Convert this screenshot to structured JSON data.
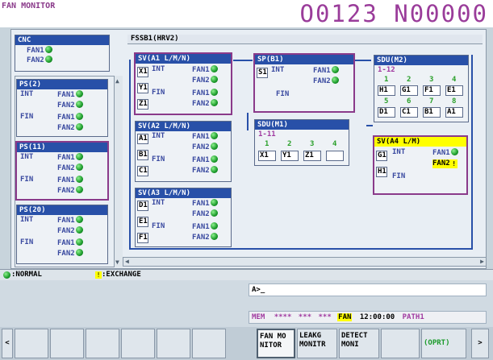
{
  "header": {
    "screen_title": "FAN MONITOR",
    "program_no": "O0123 N00000"
  },
  "cnc": {
    "title": "CNC",
    "fan1": "FAN1",
    "fan2": "FAN2"
  },
  "ps2": {
    "title": "PS(2)",
    "int": "INT",
    "fin": "FIN",
    "fan1": "FAN1",
    "fan2": "FAN2"
  },
  "ps11": {
    "title": "PS(11)",
    "int": "INT",
    "fin": "FIN",
    "fan1": "FAN1",
    "fan2": "FAN2"
  },
  "ps20": {
    "title": "PS(20)",
    "int": "INT",
    "fin": "FIN",
    "fan1": "FAN1",
    "fan2": "FAN2"
  },
  "fssb": {
    "title": "FSSB1(HRV2)"
  },
  "sva1": {
    "title": "SV(A1 L/M/N)",
    "axes": [
      "X1",
      "Y1",
      "Z1"
    ]
  },
  "sva2": {
    "title": "SV(A2 L/M/N)",
    "axes": [
      "A1",
      "B1",
      "C1"
    ]
  },
  "sva3": {
    "title": "SV(A3 L/M/N)",
    "axes": [
      "D1",
      "E1",
      "F1"
    ]
  },
  "sp": {
    "title": "SP(B1)",
    "axis": "S1",
    "int": "INT",
    "fin": "FIN",
    "fan1": "FAN1",
    "fan2": "FAN2"
  },
  "sdum1": {
    "title": "SDU(M1)",
    "range": "1-11",
    "nums": [
      "1",
      "2",
      "3",
      "4"
    ],
    "axes": [
      "X1",
      "Y1",
      "Z1",
      ""
    ]
  },
  "sdum2": {
    "title": "SDU(M2)",
    "range": "1-12",
    "nums": [
      "1",
      "2",
      "3",
      "4",
      "5",
      "6",
      "7",
      "8"
    ],
    "axes": [
      "H1",
      "G1",
      "F1",
      "E1",
      "D1",
      "C1",
      "B1",
      "A1"
    ]
  },
  "sva4": {
    "title": "SV(A4 L/M)",
    "axes": [
      "G1",
      "H1"
    ],
    "int": "INT",
    "fin": "FIN",
    "fan1": "FAN1",
    "fan2": "FAN2"
  },
  "common": {
    "int": "INT",
    "fin": "FIN",
    "fan1": "FAN1",
    "fan2": "FAN2"
  },
  "legend": {
    "normal": ":NORMAL",
    "exchange": ":EXCHANGE"
  },
  "command": {
    "prompt": "A>_"
  },
  "status": {
    "mode": "MEM",
    "stars1": "****",
    "stars2": "***",
    "stars3": "***",
    "fan": "FAN",
    "time": "12:00:00",
    "path": "PATH1"
  },
  "softkeys": {
    "back": "<",
    "fan_monitor_1": "FAN MO",
    "fan_monitor_2": "NITOR",
    "leakage_1": "LEAKG",
    "leakage_2": "MONITR",
    "detect_1": "DETECT",
    "detect_2": "MONI",
    "oprt": "(OPRT)",
    "next": ">"
  },
  "colors": {
    "normal": "#1a9a2a",
    "exchange": "#ffff00",
    "header": "#2850a8",
    "select": "#8a3a8a"
  }
}
